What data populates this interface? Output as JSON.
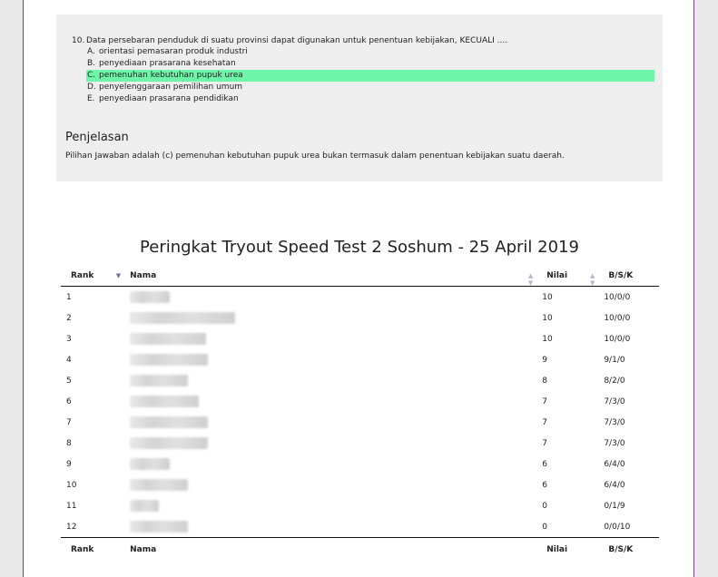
{
  "question": {
    "number": "10.",
    "stem": "Data persebaran penduduk di suatu provinsi dapat digunakan untuk penentuan kebijakan, KECUALI ....",
    "options": [
      {
        "letter": "A.",
        "text": "orientasi pemasaran produk industri",
        "correct": false
      },
      {
        "letter": "B.",
        "text": "penyediaan prasarana kesehatan",
        "correct": false
      },
      {
        "letter": "C.",
        "text": "pemenuhan kebutuhan pupuk urea",
        "correct": true
      },
      {
        "letter": "D.",
        "text": "penyelenggaraan pemilihan umum",
        "correct": false
      },
      {
        "letter": "E.",
        "text": "penyediaan prasarana pendidikan",
        "correct": false
      }
    ],
    "correct_highlight_color": "#6ef5a9"
  },
  "explanation": {
    "title": "Penjelasan",
    "text": "Pilihan Jawaban adalah (c) pemenuhan kebutuhan pupuk urea bukan termasuk dalam penentuan kebijakan suatu daerah."
  },
  "ranking": {
    "title": "Peringkat Tryout Speed Test 2 Soshum - 25 April 2019",
    "headers": {
      "rank": "Rank",
      "name": "Nama",
      "score": "Nilai",
      "bsk": "B/S/K"
    },
    "rows": [
      {
        "rank": "1",
        "score": "10",
        "bsk": "10/0/0"
      },
      {
        "rank": "2",
        "score": "10",
        "bsk": "10/0/0"
      },
      {
        "rank": "3",
        "score": "10",
        "bsk": "10/0/0"
      },
      {
        "rank": "4",
        "score": "9",
        "bsk": "9/1/0"
      },
      {
        "rank": "5",
        "score": "8",
        "bsk": "8/2/0"
      },
      {
        "rank": "6",
        "score": "7",
        "bsk": "7/3/0"
      },
      {
        "rank": "7",
        "score": "7",
        "bsk": "7/3/0"
      },
      {
        "rank": "8",
        "score": "7",
        "bsk": "7/3/0"
      },
      {
        "rank": "9",
        "score": "6",
        "bsk": "6/4/0"
      },
      {
        "rank": "10",
        "score": "6",
        "bsk": "6/4/0"
      },
      {
        "rank": "11",
        "score": "0",
        "bsk": "0/1/9"
      },
      {
        "rank": "12",
        "score": "0",
        "bsk": "0/0/10"
      }
    ]
  },
  "icons": {
    "sort_active": "sort-desc-icon",
    "sort_inactive": "sort-both-icon"
  }
}
